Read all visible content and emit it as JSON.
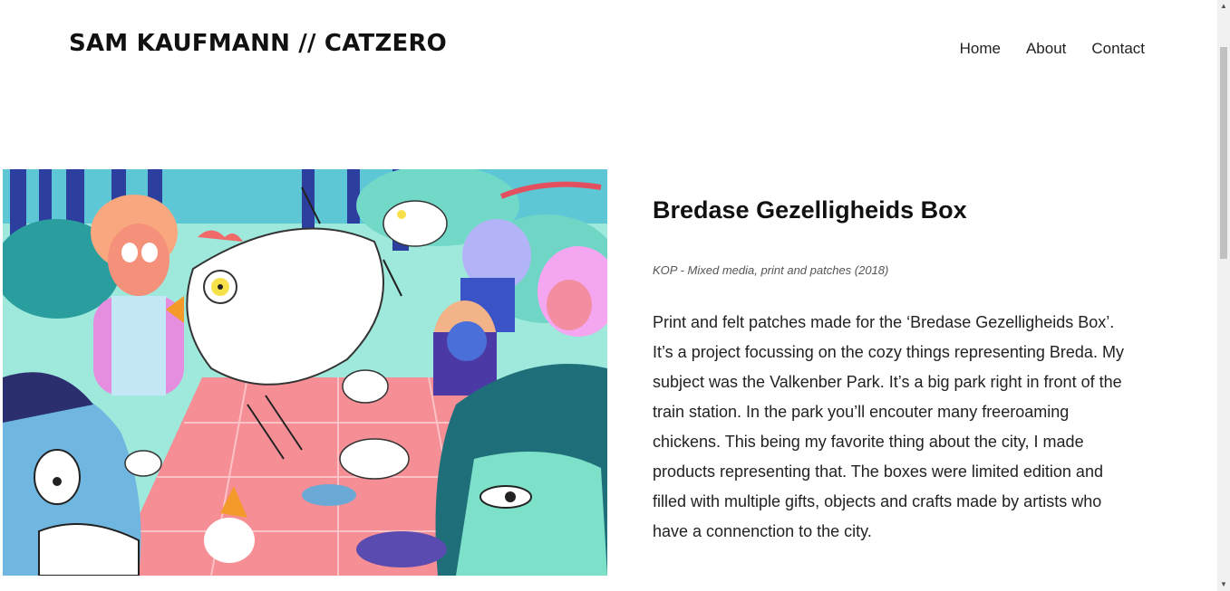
{
  "header": {
    "site_title": "SAM KAUFMANN // CATZERO",
    "nav": [
      "Home",
      "About",
      "Contact"
    ]
  },
  "artwork": {
    "description_icon": "illustration-picnic-chickens"
  },
  "post": {
    "title": "Bredase Gezelligheids Box",
    "subtitle": "KOP - Mixed media, print and patches (2018)",
    "body": "Print and felt patches made for the ‘Bredase Gezelligheids Box’. It’s a project focussing on the cozy things representing Breda. My subject was the Valkenber Park. It’s a big park right in front of the train station. In the park you’ll encouter many freeroaming chickens. This being my favorite thing about the city, I made products representing that. The boxes were limited edition and filled with multiple gifts, objects and crafts made by artists who have a connenction to the city."
  },
  "colors": {
    "accent": "#111111",
    "mint": "#8fe3d4",
    "pink": "#f48a8f",
    "purple": "#6a4fc4",
    "teal": "#1f6f7a"
  }
}
